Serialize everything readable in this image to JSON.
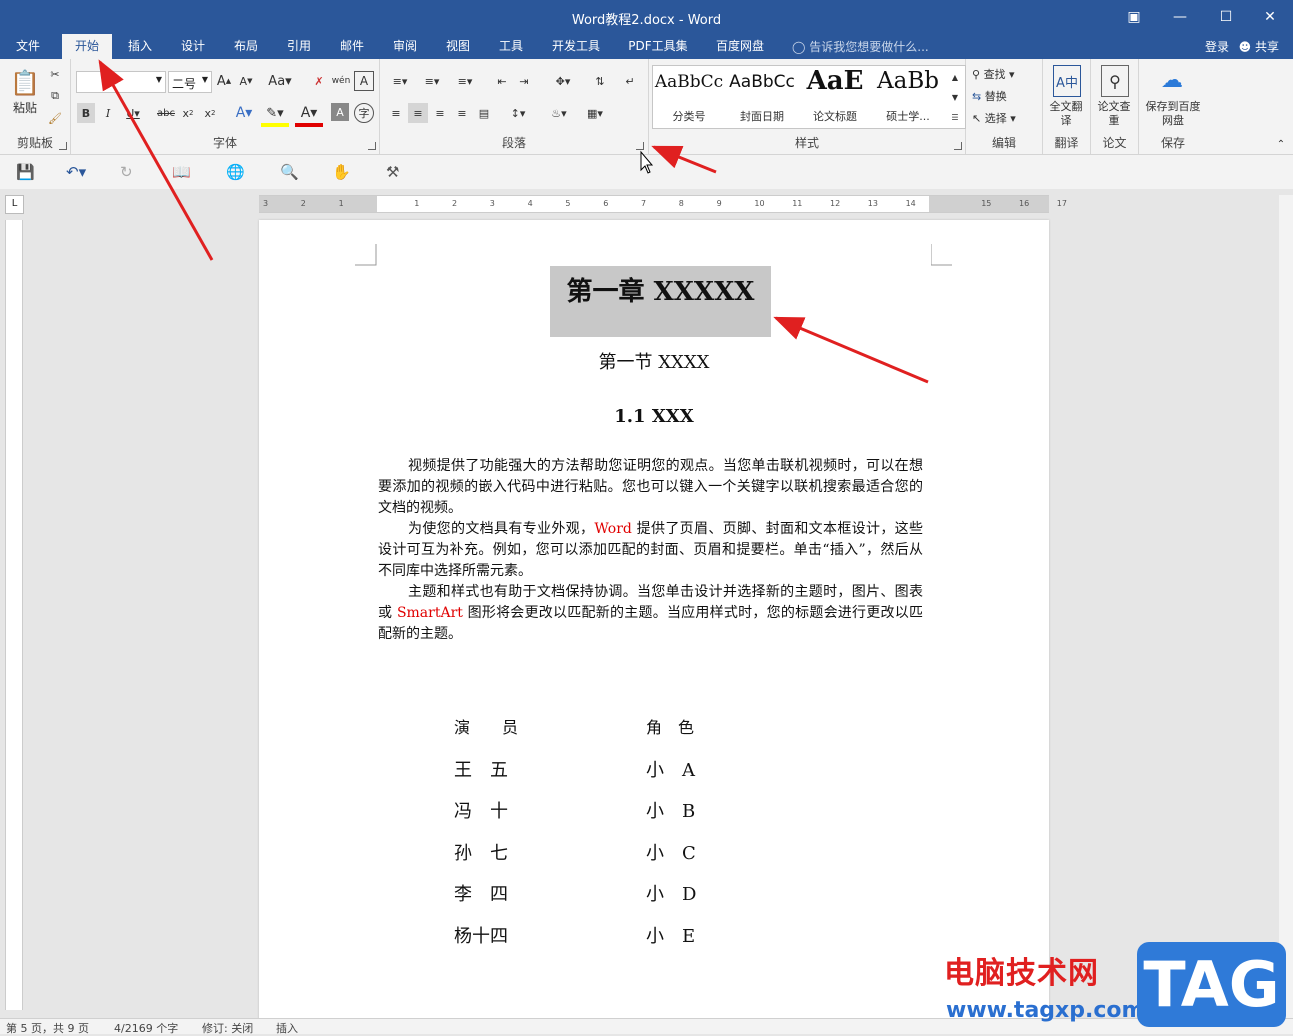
{
  "window": {
    "title": "Word教程2.docx - Word"
  },
  "tabs": [
    "文件",
    "开始",
    "插入",
    "设计",
    "布局",
    "引用",
    "邮件",
    "审阅",
    "视图",
    "工具",
    "开发工具",
    "PDF工具集",
    "百度网盘"
  ],
  "tell_me": "告诉我您想要做什么...",
  "login": "登录",
  "share": "共享",
  "ribbon": {
    "clipboard": {
      "paste": "粘贴",
      "label": "剪贴板"
    },
    "font": {
      "font_name": "",
      "font_size": "二号",
      "label": "字体"
    },
    "paragraph": {
      "label": "段落"
    },
    "styles": {
      "label": "样式",
      "items": [
        {
          "preview": "AaBbCc",
          "name": "分类号"
        },
        {
          "preview": "AaBbCc",
          "name": "封面日期"
        },
        {
          "preview": "AaE",
          "name": "论文标题"
        },
        {
          "preview": "AaBb",
          "name": "硕士学..."
        }
      ]
    },
    "editing": {
      "find": "查找",
      "replace": "替换",
      "select": "选择",
      "label": "编辑"
    },
    "translate": {
      "btn": "全文翻译",
      "label": "翻译"
    },
    "paper": {
      "btn": "论文查重",
      "label": "论文"
    },
    "save": {
      "btn": "保存到百度网盘",
      "label": "保存"
    }
  },
  "document": {
    "heading1": "第一章  XXXXX",
    "heading2": "第一节  XXXX",
    "heading3": "1.1 XXX",
    "p1": "视频提供了功能强大的方法帮助您证明您的观点。当您单击联机视频时，可以在想要添加的视频的嵌入代码中进行粘贴。您也可以键入一个关键字以联机搜索最适合您的文档的视频。",
    "p2_a": "为使您的文档具有专业外观，",
    "p2_word": "Word",
    "p2_b": " 提供了页眉、页脚、封面和文本框设计，这些设计可互为补充。例如，您可以添加匹配的封面、页眉和提要栏。单击“插入”，然后从不同库中选择所需元素。",
    "p3_a": "主题和样式也有助于文档保持协调。当您单击设计并选择新的主题时，图片、图表或 ",
    "p3_smart": "SmartArt",
    "p3_b": " 图形将会更改以匹配新的主题。当应用样式时，您的标题会进行更改以匹配新的主题。",
    "cast_header": {
      "actor": "演　　员",
      "role": "角　色"
    },
    "cast": [
      {
        "actor": "王　五",
        "role": "小　A"
      },
      {
        "actor": "冯　十",
        "role": "小　B"
      },
      {
        "actor": "孙　七",
        "role": "小　C"
      },
      {
        "actor": "李　四",
        "role": "小　D"
      },
      {
        "actor": "杨十四",
        "role": "小　E"
      }
    ]
  },
  "status": {
    "page": "第 5 页，共 9 页",
    "words": "4/2169 个字",
    "track": "修订: 关闭",
    "insert": "插入"
  },
  "watermark": {
    "cn": "电脑技术网",
    "url": "www.tagxp.com",
    "tag": "TAG"
  },
  "colors": {
    "accent": "#2b579a",
    "arrow": "#e02020"
  }
}
